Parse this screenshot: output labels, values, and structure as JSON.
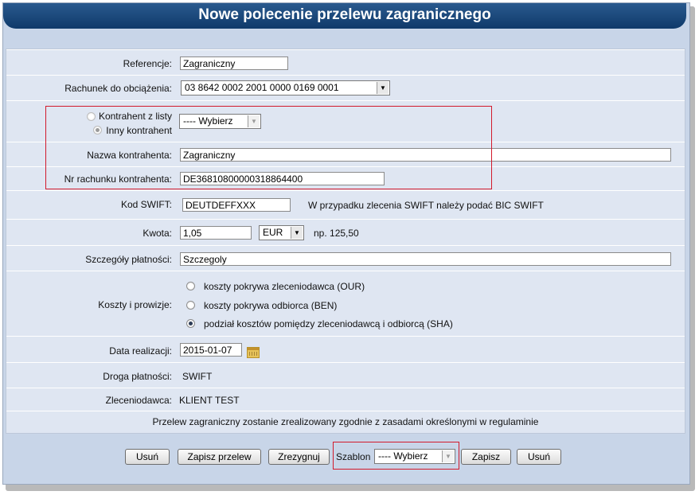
{
  "title": "Nowe polecenie przelewu zagranicznego",
  "fields": {
    "referencje_label": "Referencje:",
    "referencje_value": "Zagraniczny",
    "rachunek_label": "Rachunek do obciążenia:",
    "rachunek_value": "03 8642 0002 2001 0000 0169 0001",
    "kontrahent_z_listy_label": "Kontrahent z listy",
    "inny_kontrahent_label": "Inny kontrahent",
    "kontrahent_select_value": "---- Wybierz",
    "nazwa_label": "Nazwa kontrahenta:",
    "nazwa_value": "Zagraniczny",
    "nr_rachunku_label": "Nr rachunku kontrahenta:",
    "nr_rachunku_value": "DE36810800000318864400",
    "swift_label": "Kod SWIFT:",
    "swift_value": "DEUTDEFFXXX",
    "swift_hint": "W przypadku zlecenia SWIFT należy podać BIC SWIFT",
    "kwota_label": "Kwota:",
    "kwota_value": "1,05",
    "waluta_value": "EUR",
    "kwota_hint": "np. 125,50",
    "szczegoly_label": "Szczegóły płatności:",
    "szczegoly_value": "Szczegoly",
    "koszty_label": "Koszty i prowizje:",
    "koszty_options": [
      "koszty pokrywa zleceniodawca (OUR)",
      "koszty pokrywa odbiorca (BEN)",
      "podział kosztów pomiędzy zleceniodawcą i odbiorcą (SHA)"
    ],
    "koszty_selected_index": 2,
    "data_label": "Data realizacji:",
    "data_value": "2015-01-07",
    "droga_label": "Droga płatności:",
    "droga_value": "SWIFT",
    "zleceniodawca_label": "Zleceniodawca:",
    "zleceniodawca_value": "KLIENT TEST",
    "note": "Przelew zagraniczny zostanie zrealizowany zgodnie z zasadami określonymi w regulaminie"
  },
  "buttons": {
    "usun": "Usuń",
    "zapisz_przelew": "Zapisz przelew",
    "zrezygnuj": "Zrezygnuj",
    "szablon_label": "Szablon",
    "szablon_select": "---- Wybierz",
    "zapisz": "Zapisz",
    "usun2": "Usuń"
  },
  "colors": {
    "title_bar": "#1b4a7c",
    "panel": "#c8d5e8",
    "row": "#dfe6f2",
    "highlight_border": "#d21a2c"
  }
}
